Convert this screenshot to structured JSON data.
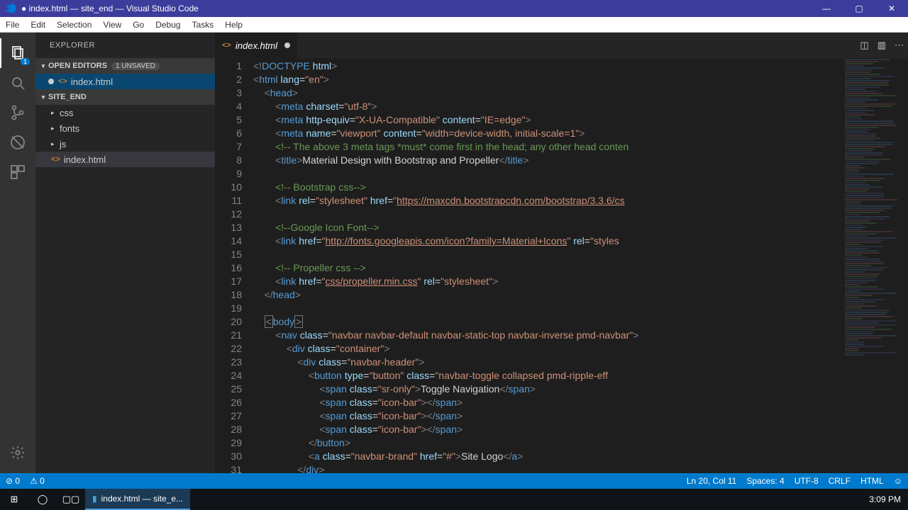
{
  "titlebar": {
    "title": "● index.html — site_end — Visual Studio Code"
  },
  "window_controls": {
    "min": "—",
    "max": "▢",
    "close": "✕"
  },
  "menu": [
    "File",
    "Edit",
    "Selection",
    "View",
    "Go",
    "Debug",
    "Tasks",
    "Help"
  ],
  "activity": {
    "explorer_badge": "1"
  },
  "explorer": {
    "title": "EXPLORER",
    "open_editors_label": "OPEN EDITORS",
    "unsaved_badge": "1 UNSAVED",
    "project_label": "SITE_END",
    "open_file": "index.html",
    "folders": [
      {
        "name": "css"
      },
      {
        "name": "fonts"
      },
      {
        "name": "js"
      }
    ],
    "root_file": "index.html"
  },
  "tab": {
    "name": "index.html"
  },
  "code_lines": [
    {
      "n": "1",
      "ind": 0,
      "seg": [
        {
          "c": "t-gray",
          "t": "<!"
        },
        {
          "c": "t-blue",
          "t": "DOCTYPE "
        },
        {
          "c": "t-lblue",
          "t": "html"
        },
        {
          "c": "t-gray",
          "t": ">"
        }
      ]
    },
    {
      "n": "2",
      "ind": 0,
      "seg": [
        {
          "c": "t-gray",
          "t": "<"
        },
        {
          "c": "t-blue",
          "t": "html "
        },
        {
          "c": "t-lblue",
          "t": "lang"
        },
        {
          "c": "t-white",
          "t": "="
        },
        {
          "c": "t-str",
          "t": "\"en\""
        },
        {
          "c": "t-gray",
          "t": ">"
        }
      ]
    },
    {
      "n": "3",
      "ind": 1,
      "seg": [
        {
          "c": "t-gray",
          "t": "<"
        },
        {
          "c": "t-blue",
          "t": "head"
        },
        {
          "c": "t-gray",
          "t": ">"
        }
      ]
    },
    {
      "n": "4",
      "ind": 2,
      "seg": [
        {
          "c": "t-gray",
          "t": "<"
        },
        {
          "c": "t-blue",
          "t": "meta "
        },
        {
          "c": "t-lblue",
          "t": "charset"
        },
        {
          "c": "t-white",
          "t": "="
        },
        {
          "c": "t-str",
          "t": "\"utf-8\""
        },
        {
          "c": "t-gray",
          "t": ">"
        }
      ]
    },
    {
      "n": "5",
      "ind": 2,
      "seg": [
        {
          "c": "t-gray",
          "t": "<"
        },
        {
          "c": "t-blue",
          "t": "meta "
        },
        {
          "c": "t-lblue",
          "t": "http-equiv"
        },
        {
          "c": "t-white",
          "t": "="
        },
        {
          "c": "t-str",
          "t": "\"X-UA-Compatible\" "
        },
        {
          "c": "t-lblue",
          "t": "content"
        },
        {
          "c": "t-white",
          "t": "="
        },
        {
          "c": "t-str",
          "t": "\"IE=edge\""
        },
        {
          "c": "t-gray",
          "t": ">"
        }
      ]
    },
    {
      "n": "6",
      "ind": 2,
      "seg": [
        {
          "c": "t-gray",
          "t": "<"
        },
        {
          "c": "t-blue",
          "t": "meta "
        },
        {
          "c": "t-lblue",
          "t": "name"
        },
        {
          "c": "t-white",
          "t": "="
        },
        {
          "c": "t-str",
          "t": "\"viewport\" "
        },
        {
          "c": "t-lblue",
          "t": "content"
        },
        {
          "c": "t-white",
          "t": "="
        },
        {
          "c": "t-str",
          "t": "\"width=device-width, initial-scale=1\""
        },
        {
          "c": "t-gray",
          "t": ">"
        }
      ]
    },
    {
      "n": "7",
      "ind": 2,
      "seg": [
        {
          "c": "t-cmt",
          "t": "<!-- The above 3 meta tags *must* come first in the head; any other head conten"
        }
      ]
    },
    {
      "n": "8",
      "ind": 2,
      "seg": [
        {
          "c": "t-gray",
          "t": "<"
        },
        {
          "c": "t-blue",
          "t": "title"
        },
        {
          "c": "t-gray",
          "t": ">"
        },
        {
          "c": "t-white",
          "t": "Material Design with Bootstrap and Propeller"
        },
        {
          "c": "t-gray",
          "t": "</"
        },
        {
          "c": "t-blue",
          "t": "title"
        },
        {
          "c": "t-gray",
          "t": ">"
        }
      ]
    },
    {
      "n": "9",
      "ind": 0,
      "seg": []
    },
    {
      "n": "10",
      "ind": 2,
      "seg": [
        {
          "c": "t-cmt",
          "t": "<!-- Bootstrap css-->"
        }
      ]
    },
    {
      "n": "11",
      "ind": 2,
      "seg": [
        {
          "c": "t-gray",
          "t": "<"
        },
        {
          "c": "t-blue",
          "t": "link "
        },
        {
          "c": "t-lblue",
          "t": "rel"
        },
        {
          "c": "t-white",
          "t": "="
        },
        {
          "c": "t-str",
          "t": "\"stylesheet\" "
        },
        {
          "c": "t-lblue",
          "t": "href"
        },
        {
          "c": "t-white",
          "t": "="
        },
        {
          "c": "t-str",
          "t": "\""
        },
        {
          "c": "t-link",
          "t": "https://maxcdn.bootstrapcdn.com/bootstrap/3.3.6/cs"
        }
      ]
    },
    {
      "n": "12",
      "ind": 0,
      "seg": []
    },
    {
      "n": "13",
      "ind": 2,
      "seg": [
        {
          "c": "t-cmt",
          "t": "<!--Google Icon Font-->"
        }
      ]
    },
    {
      "n": "14",
      "ind": 2,
      "seg": [
        {
          "c": "t-gray",
          "t": "<"
        },
        {
          "c": "t-blue",
          "t": "link "
        },
        {
          "c": "t-lblue",
          "t": "href"
        },
        {
          "c": "t-white",
          "t": "="
        },
        {
          "c": "t-str",
          "t": "\""
        },
        {
          "c": "t-link",
          "t": "http://fonts.googleapis.com/icon?family=Material+Icons"
        },
        {
          "c": "t-str",
          "t": "\" "
        },
        {
          "c": "t-lblue",
          "t": "rel"
        },
        {
          "c": "t-white",
          "t": "="
        },
        {
          "c": "t-str",
          "t": "\"styles"
        }
      ]
    },
    {
      "n": "15",
      "ind": 0,
      "seg": []
    },
    {
      "n": "16",
      "ind": 2,
      "seg": [
        {
          "c": "t-cmt",
          "t": "<!-- Propeller css -->"
        }
      ]
    },
    {
      "n": "17",
      "ind": 2,
      "seg": [
        {
          "c": "t-gray",
          "t": "<"
        },
        {
          "c": "t-blue",
          "t": "link "
        },
        {
          "c": "t-lblue",
          "t": "href"
        },
        {
          "c": "t-white",
          "t": "="
        },
        {
          "c": "t-str",
          "t": "\""
        },
        {
          "c": "t-link",
          "t": "css/propeller.min.css"
        },
        {
          "c": "t-str",
          "t": "\" "
        },
        {
          "c": "t-lblue",
          "t": "rel"
        },
        {
          "c": "t-white",
          "t": "="
        },
        {
          "c": "t-str",
          "t": "\"stylesheet\""
        },
        {
          "c": "t-gray",
          "t": ">"
        }
      ]
    },
    {
      "n": "18",
      "ind": 1,
      "seg": [
        {
          "c": "t-gray",
          "t": "</"
        },
        {
          "c": "t-blue",
          "t": "head"
        },
        {
          "c": "t-gray",
          "t": ">"
        }
      ]
    },
    {
      "n": "19",
      "ind": 0,
      "seg": []
    },
    {
      "n": "20",
      "ind": 1,
      "seg": [
        {
          "c": "t-gray t-box",
          "t": "<"
        },
        {
          "c": "t-blue",
          "t": "body"
        },
        {
          "c": "t-gray t-box",
          "t": ">"
        }
      ]
    },
    {
      "n": "21",
      "ind": 2,
      "seg": [
        {
          "c": "t-gray",
          "t": "<"
        },
        {
          "c": "t-blue",
          "t": "nav "
        },
        {
          "c": "t-lblue",
          "t": "class"
        },
        {
          "c": "t-white",
          "t": "="
        },
        {
          "c": "t-str",
          "t": "\"navbar navbar-default navbar-static-top navbar-inverse pmd-navbar\""
        },
        {
          "c": "t-gray",
          "t": ">"
        }
      ]
    },
    {
      "n": "22",
      "ind": 3,
      "seg": [
        {
          "c": "t-gray",
          "t": "<"
        },
        {
          "c": "t-blue",
          "t": "div "
        },
        {
          "c": "t-lblue",
          "t": "class"
        },
        {
          "c": "t-white",
          "t": "="
        },
        {
          "c": "t-str",
          "t": "\"container\""
        },
        {
          "c": "t-gray",
          "t": ">"
        }
      ]
    },
    {
      "n": "23",
      "ind": 4,
      "seg": [
        {
          "c": "t-gray",
          "t": "<"
        },
        {
          "c": "t-blue",
          "t": "div "
        },
        {
          "c": "t-lblue",
          "t": "class"
        },
        {
          "c": "t-white",
          "t": "="
        },
        {
          "c": "t-str",
          "t": "\"navbar-header\""
        },
        {
          "c": "t-gray",
          "t": ">"
        }
      ]
    },
    {
      "n": "24",
      "ind": 5,
      "seg": [
        {
          "c": "t-gray",
          "t": "<"
        },
        {
          "c": "t-blue",
          "t": "button "
        },
        {
          "c": "t-lblue",
          "t": "type"
        },
        {
          "c": "t-white",
          "t": "="
        },
        {
          "c": "t-str",
          "t": "\"button\" "
        },
        {
          "c": "t-lblue",
          "t": "class"
        },
        {
          "c": "t-white",
          "t": "="
        },
        {
          "c": "t-str",
          "t": "\"navbar-toggle collapsed pmd-ripple-eff"
        }
      ]
    },
    {
      "n": "25",
      "ind": 6,
      "seg": [
        {
          "c": "t-gray",
          "t": "<"
        },
        {
          "c": "t-blue",
          "t": "span "
        },
        {
          "c": "t-lblue",
          "t": "class"
        },
        {
          "c": "t-white",
          "t": "="
        },
        {
          "c": "t-str",
          "t": "\"sr-only\""
        },
        {
          "c": "t-gray",
          "t": ">"
        },
        {
          "c": "t-white",
          "t": "Toggle Navigation"
        },
        {
          "c": "t-gray",
          "t": "</"
        },
        {
          "c": "t-blue",
          "t": "span"
        },
        {
          "c": "t-gray",
          "t": ">"
        }
      ]
    },
    {
      "n": "26",
      "ind": 6,
      "seg": [
        {
          "c": "t-gray",
          "t": "<"
        },
        {
          "c": "t-blue",
          "t": "span "
        },
        {
          "c": "t-lblue",
          "t": "class"
        },
        {
          "c": "t-white",
          "t": "="
        },
        {
          "c": "t-str",
          "t": "\"icon-bar\""
        },
        {
          "c": "t-gray",
          "t": "></"
        },
        {
          "c": "t-blue",
          "t": "span"
        },
        {
          "c": "t-gray",
          "t": ">"
        }
      ]
    },
    {
      "n": "27",
      "ind": 6,
      "seg": [
        {
          "c": "t-gray",
          "t": "<"
        },
        {
          "c": "t-blue",
          "t": "span "
        },
        {
          "c": "t-lblue",
          "t": "class"
        },
        {
          "c": "t-white",
          "t": "="
        },
        {
          "c": "t-str",
          "t": "\"icon-bar\""
        },
        {
          "c": "t-gray",
          "t": "></"
        },
        {
          "c": "t-blue",
          "t": "span"
        },
        {
          "c": "t-gray",
          "t": ">"
        }
      ]
    },
    {
      "n": "28",
      "ind": 6,
      "seg": [
        {
          "c": "t-gray",
          "t": "<"
        },
        {
          "c": "t-blue",
          "t": "span "
        },
        {
          "c": "t-lblue",
          "t": "class"
        },
        {
          "c": "t-white",
          "t": "="
        },
        {
          "c": "t-str",
          "t": "\"icon-bar\""
        },
        {
          "c": "t-gray",
          "t": "></"
        },
        {
          "c": "t-blue",
          "t": "span"
        },
        {
          "c": "t-gray",
          "t": ">"
        }
      ]
    },
    {
      "n": "29",
      "ind": 5,
      "seg": [
        {
          "c": "t-gray",
          "t": "</"
        },
        {
          "c": "t-blue",
          "t": "button"
        },
        {
          "c": "t-gray",
          "t": ">"
        }
      ]
    },
    {
      "n": "30",
      "ind": 5,
      "seg": [
        {
          "c": "t-gray",
          "t": "<"
        },
        {
          "c": "t-blue",
          "t": "a "
        },
        {
          "c": "t-lblue",
          "t": "class"
        },
        {
          "c": "t-white",
          "t": "="
        },
        {
          "c": "t-str",
          "t": "\"navbar-brand\" "
        },
        {
          "c": "t-lblue",
          "t": "href"
        },
        {
          "c": "t-white",
          "t": "="
        },
        {
          "c": "t-str",
          "t": "\"#\""
        },
        {
          "c": "t-gray",
          "t": ">"
        },
        {
          "c": "t-white",
          "t": "Site Logo"
        },
        {
          "c": "t-gray",
          "t": "</"
        },
        {
          "c": "t-blue",
          "t": "a"
        },
        {
          "c": "t-gray",
          "t": ">"
        }
      ]
    },
    {
      "n": "31",
      "ind": 4,
      "seg": [
        {
          "c": "t-gray",
          "t": "</"
        },
        {
          "c": "t-blue",
          "t": "div"
        },
        {
          "c": "t-gray",
          "t": ">"
        }
      ]
    }
  ],
  "status": {
    "errors": "0",
    "warnings": "0",
    "position": "Ln 20, Col 11",
    "spaces": "Spaces: 4",
    "encoding": "UTF-8",
    "eol": "CRLF",
    "lang": "HTML"
  },
  "taskbar": {
    "app": "index.html — site_e...",
    "time": "3:09 PM"
  }
}
